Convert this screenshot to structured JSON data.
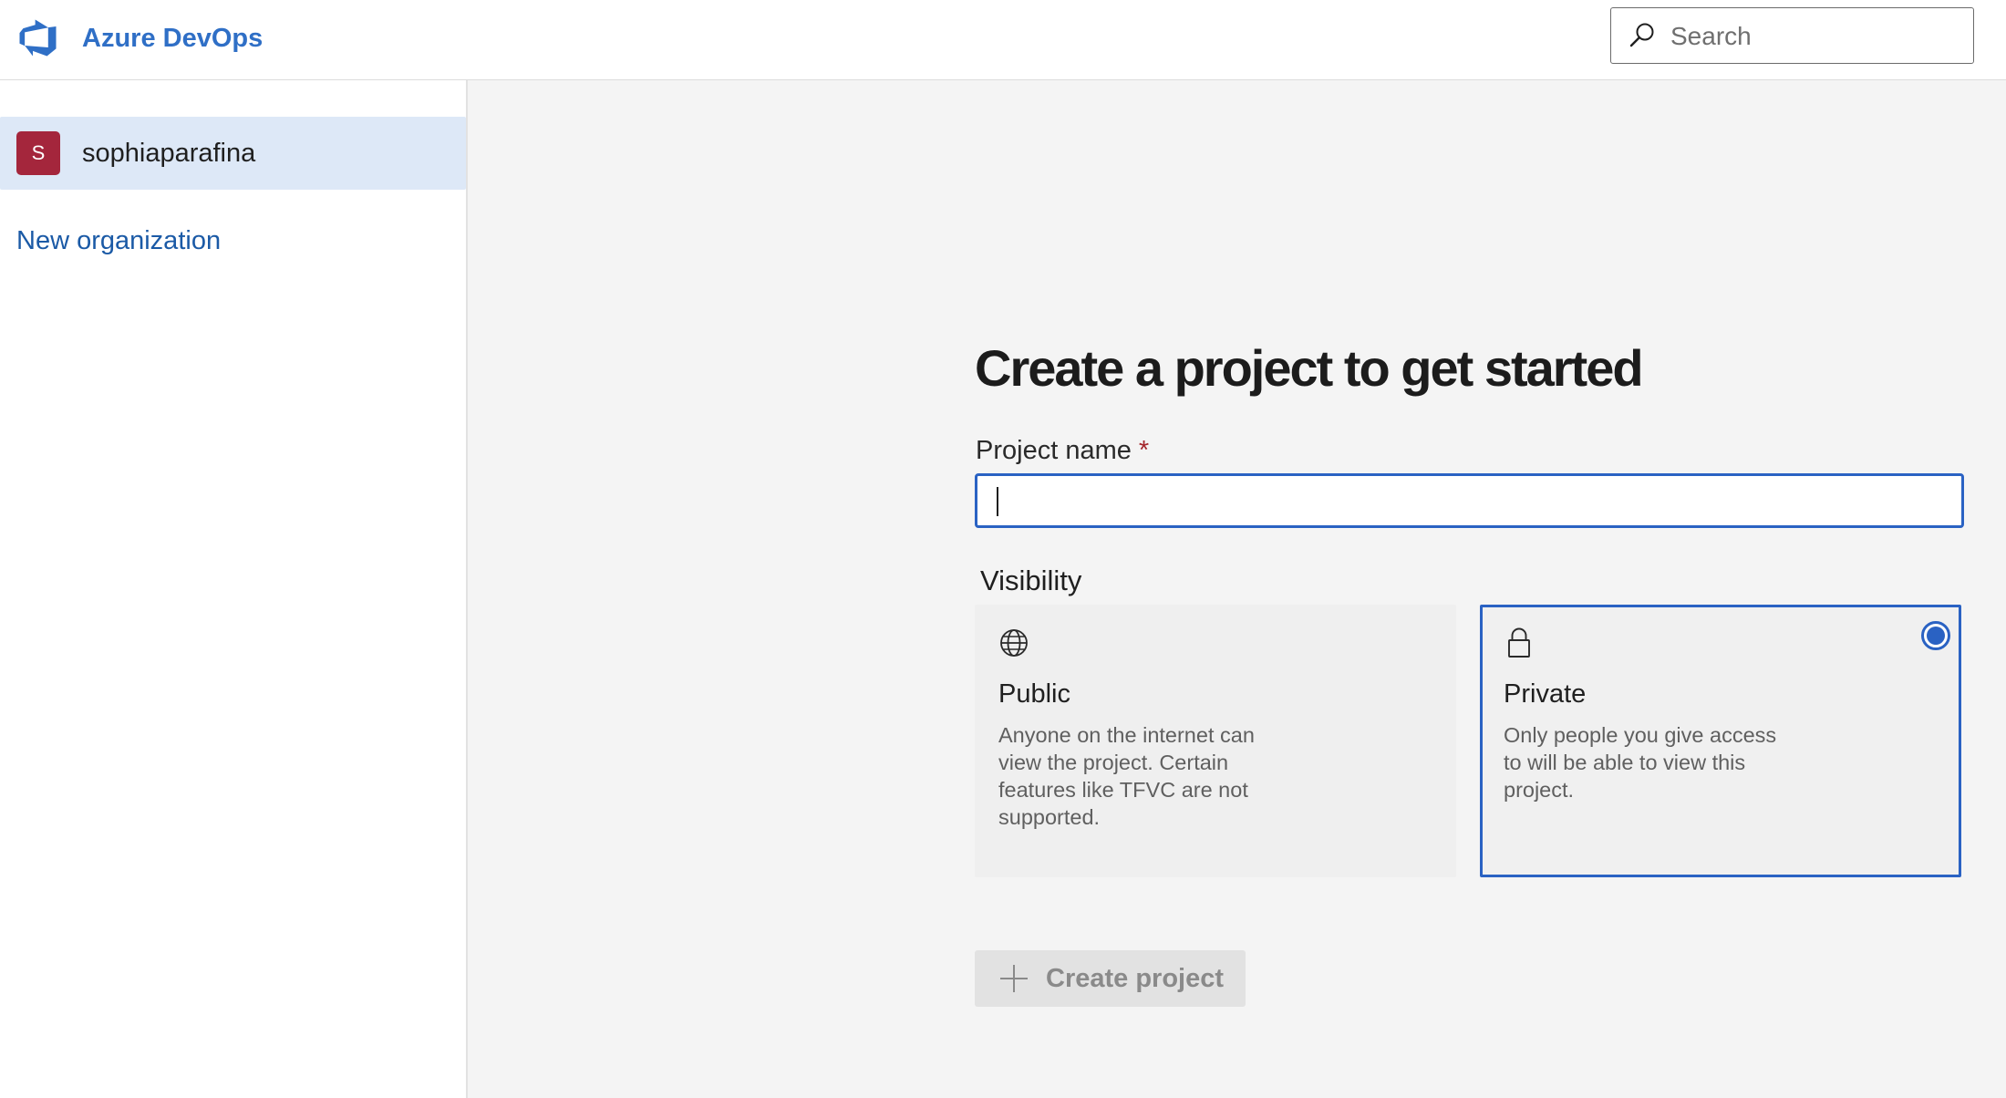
{
  "header": {
    "brand": "Azure DevOps",
    "logo_icon": "azure-devops-logo-icon",
    "search_placeholder": "Search",
    "accent_color": "#2f6fc6"
  },
  "sidebar": {
    "organizations": [
      {
        "initial": "S",
        "name": "sophiaparafina",
        "avatar_color": "#a4263c",
        "selected": true
      }
    ],
    "new_org_link": "New organization"
  },
  "main": {
    "title": "Create a project to get started",
    "project_name": {
      "label": "Project name",
      "required_marker": "*",
      "value": ""
    },
    "visibility": {
      "label": "Visibility",
      "selected": "Private",
      "options": [
        {
          "icon": "globe-icon",
          "title": "Public",
          "description": "Anyone on the internet can view the project. Certain features like TFVC are not supported."
        },
        {
          "icon": "lock-icon",
          "title": "Private",
          "description": "Only people you give access to will be able to view this project."
        }
      ]
    },
    "create_button": {
      "label": "Create project",
      "icon": "plus-icon",
      "enabled": false
    }
  }
}
